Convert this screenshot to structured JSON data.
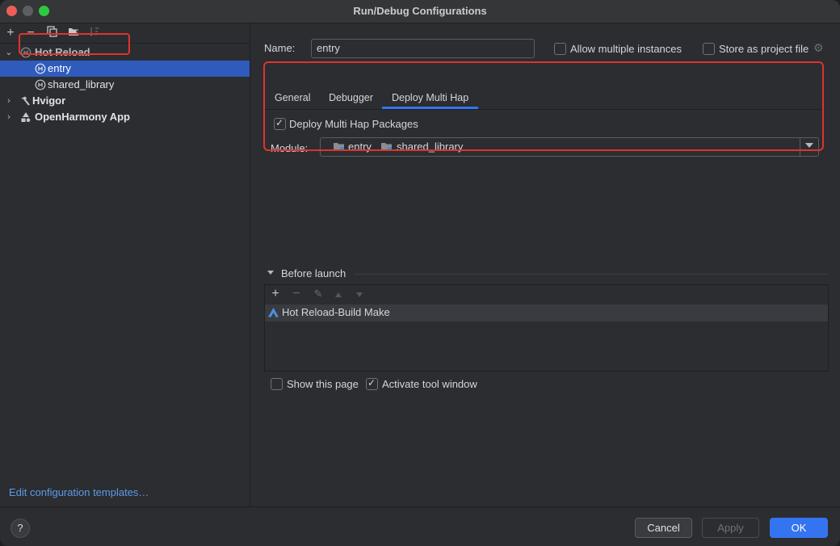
{
  "window": {
    "title": "Run/Debug Configurations"
  },
  "left_panel": {
    "toolbar": [
      "add",
      "remove",
      "copy",
      "move-to-folder",
      "sort"
    ],
    "tree": [
      {
        "label": "Hot Reload",
        "bold": true,
        "expanded": true
      },
      {
        "label": "entry",
        "selected": true
      },
      {
        "label": "shared_library"
      },
      {
        "label": "Hvigor",
        "bold": true
      },
      {
        "label": "OpenHarmony App",
        "bold": true
      }
    ],
    "edit_templates": "Edit configuration templates…"
  },
  "config": {
    "name_label": "Name:",
    "name_value": "entry",
    "allow_multiple": {
      "label": "Allow multiple instances",
      "checked": false
    },
    "store_as_project": {
      "label": "Store as project file",
      "checked": false
    },
    "tabs": [
      {
        "label": "General"
      },
      {
        "label": "Debugger"
      },
      {
        "label": "Deploy Multi Hap",
        "active": true
      }
    ],
    "deploy_packages": {
      "label": "Deploy Multi Hap Packages",
      "checked": true
    },
    "module_label": "Module:",
    "modules": [
      "entry",
      "shared_library"
    ]
  },
  "before_launch": {
    "title": "Before launch",
    "items": [
      {
        "label": "Hot Reload-Build Make"
      }
    ],
    "show_page": {
      "label": "Show this page",
      "checked": false
    },
    "activate_tool": {
      "label": "Activate tool window",
      "checked": true
    }
  },
  "buttons": {
    "help": "?",
    "cancel": "Cancel",
    "apply": "Apply",
    "ok": "OK"
  },
  "colors": {
    "accent": "#3574f0",
    "highlight": "#e0332d",
    "link": "#5c9be6"
  }
}
